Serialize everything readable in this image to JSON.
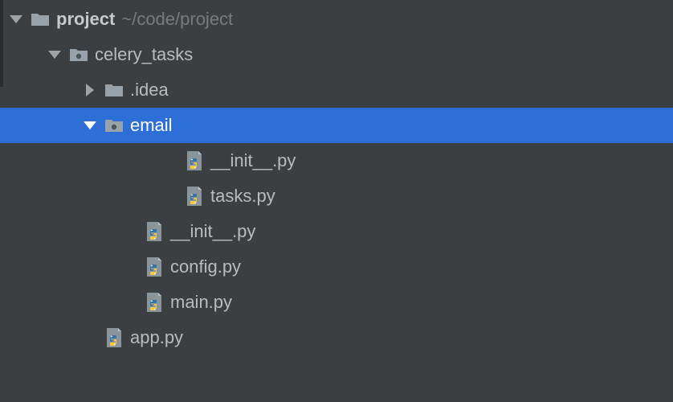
{
  "tree": {
    "root": {
      "name": "project",
      "path": "~/code/project"
    },
    "celery_tasks": {
      "name": "celery_tasks"
    },
    "idea": {
      "name": ".idea"
    },
    "email": {
      "name": "email"
    },
    "email_init": {
      "name": "__init__.py"
    },
    "email_tasks": {
      "name": "tasks.py"
    },
    "ct_init": {
      "name": "__init__.py"
    },
    "ct_config": {
      "name": "config.py"
    },
    "ct_main": {
      "name": "main.py"
    },
    "app_py": {
      "name": "app.py"
    }
  },
  "selected": "email"
}
